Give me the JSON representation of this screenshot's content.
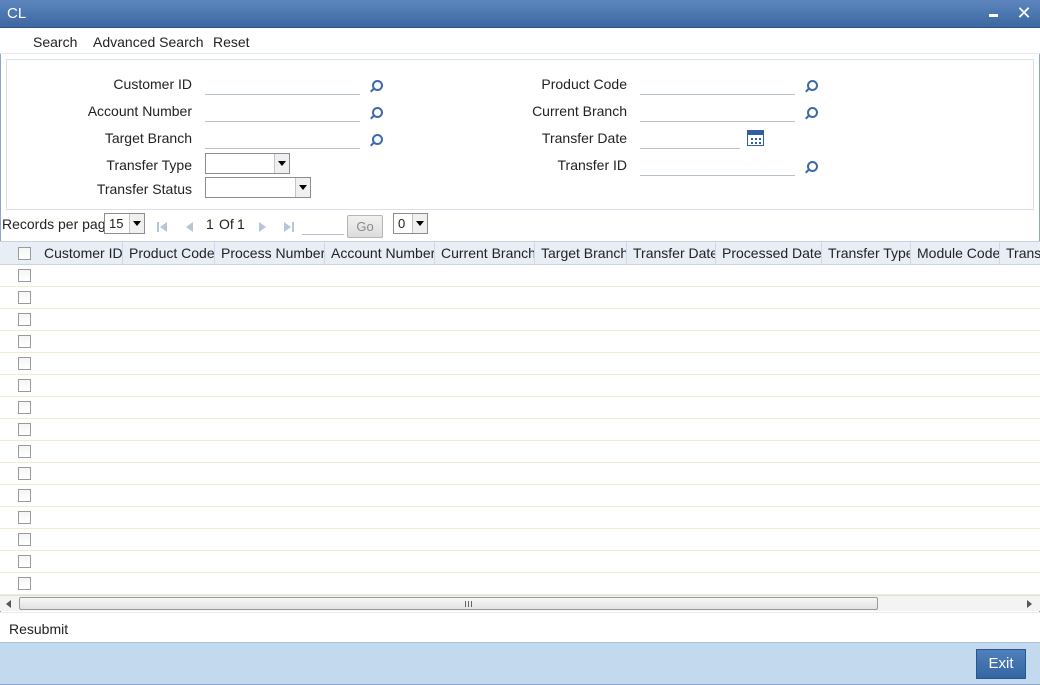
{
  "window": {
    "title": "CL",
    "minimize_icon": "minimize-icon",
    "close_icon": "close-icon"
  },
  "toolbar": {
    "search": "Search",
    "advanced_search": "Advanced Search",
    "reset": "Reset"
  },
  "criteria": {
    "customer_id": "Customer ID",
    "account_number": "Account Number",
    "target_branch": "Target Branch",
    "transfer_type": "Transfer Type",
    "transfer_status": "Transfer Status",
    "product_code": "Product Code",
    "current_branch": "Current Branch",
    "transfer_date": "Transfer Date",
    "transfer_id": "Transfer ID"
  },
  "pager": {
    "records_per_page_label": "Records per page",
    "records_per_page_value": "15",
    "current_page": "1",
    "of_label": "Of",
    "total_pages": "1",
    "go_label": "Go",
    "extra_select_value": "0"
  },
  "grid": {
    "columns": [
      "Customer ID",
      "Product Code",
      "Process Number",
      "Account Number",
      "Current Branch",
      "Target Branch",
      "Transfer Date",
      "Processed Date",
      "Transfer Type",
      "Module Code",
      "Transfer"
    ],
    "row_count": 15
  },
  "actions": {
    "resubmit": "Resubmit"
  },
  "footer": {
    "exit": "Exit"
  }
}
